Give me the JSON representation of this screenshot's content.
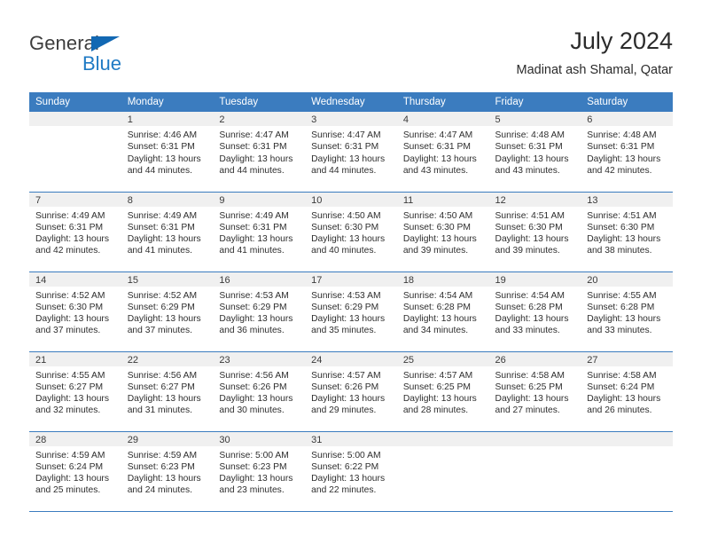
{
  "brand": {
    "general": "General",
    "blue": "Blue",
    "triangle_color": "#1268b3",
    "blue_text_color": "#1f7ac4"
  },
  "header": {
    "title": "July 2024",
    "subtitle": "Madinat ash Shamal, Qatar"
  },
  "theme": {
    "header_bar_color": "#3b7cbf",
    "daynum_bg_color": "#f0f0f0",
    "row_border_color": "#3b7cbf",
    "text_color": "#2e2e2e"
  },
  "calendar": {
    "weekday_headers": [
      "Sunday",
      "Monday",
      "Tuesday",
      "Wednesday",
      "Thursday",
      "Friday",
      "Saturday"
    ],
    "weeks": [
      [
        {
          "day": "",
          "lines": []
        },
        {
          "day": "1",
          "lines": [
            "Sunrise: 4:46 AM",
            "Sunset: 6:31 PM",
            "Daylight: 13 hours",
            "and 44 minutes."
          ]
        },
        {
          "day": "2",
          "lines": [
            "Sunrise: 4:47 AM",
            "Sunset: 6:31 PM",
            "Daylight: 13 hours",
            "and 44 minutes."
          ]
        },
        {
          "day": "3",
          "lines": [
            "Sunrise: 4:47 AM",
            "Sunset: 6:31 PM",
            "Daylight: 13 hours",
            "and 44 minutes."
          ]
        },
        {
          "day": "4",
          "lines": [
            "Sunrise: 4:47 AM",
            "Sunset: 6:31 PM",
            "Daylight: 13 hours",
            "and 43 minutes."
          ]
        },
        {
          "day": "5",
          "lines": [
            "Sunrise: 4:48 AM",
            "Sunset: 6:31 PM",
            "Daylight: 13 hours",
            "and 43 minutes."
          ]
        },
        {
          "day": "6",
          "lines": [
            "Sunrise: 4:48 AM",
            "Sunset: 6:31 PM",
            "Daylight: 13 hours",
            "and 42 minutes."
          ]
        }
      ],
      [
        {
          "day": "7",
          "lines": [
            "Sunrise: 4:49 AM",
            "Sunset: 6:31 PM",
            "Daylight: 13 hours",
            "and 42 minutes."
          ]
        },
        {
          "day": "8",
          "lines": [
            "Sunrise: 4:49 AM",
            "Sunset: 6:31 PM",
            "Daylight: 13 hours",
            "and 41 minutes."
          ]
        },
        {
          "day": "9",
          "lines": [
            "Sunrise: 4:49 AM",
            "Sunset: 6:31 PM",
            "Daylight: 13 hours",
            "and 41 minutes."
          ]
        },
        {
          "day": "10",
          "lines": [
            "Sunrise: 4:50 AM",
            "Sunset: 6:30 PM",
            "Daylight: 13 hours",
            "and 40 minutes."
          ]
        },
        {
          "day": "11",
          "lines": [
            "Sunrise: 4:50 AM",
            "Sunset: 6:30 PM",
            "Daylight: 13 hours",
            "and 39 minutes."
          ]
        },
        {
          "day": "12",
          "lines": [
            "Sunrise: 4:51 AM",
            "Sunset: 6:30 PM",
            "Daylight: 13 hours",
            "and 39 minutes."
          ]
        },
        {
          "day": "13",
          "lines": [
            "Sunrise: 4:51 AM",
            "Sunset: 6:30 PM",
            "Daylight: 13 hours",
            "and 38 minutes."
          ]
        }
      ],
      [
        {
          "day": "14",
          "lines": [
            "Sunrise: 4:52 AM",
            "Sunset: 6:30 PM",
            "Daylight: 13 hours",
            "and 37 minutes."
          ]
        },
        {
          "day": "15",
          "lines": [
            "Sunrise: 4:52 AM",
            "Sunset: 6:29 PM",
            "Daylight: 13 hours",
            "and 37 minutes."
          ]
        },
        {
          "day": "16",
          "lines": [
            "Sunrise: 4:53 AM",
            "Sunset: 6:29 PM",
            "Daylight: 13 hours",
            "and 36 minutes."
          ]
        },
        {
          "day": "17",
          "lines": [
            "Sunrise: 4:53 AM",
            "Sunset: 6:29 PM",
            "Daylight: 13 hours",
            "and 35 minutes."
          ]
        },
        {
          "day": "18",
          "lines": [
            "Sunrise: 4:54 AM",
            "Sunset: 6:28 PM",
            "Daylight: 13 hours",
            "and 34 minutes."
          ]
        },
        {
          "day": "19",
          "lines": [
            "Sunrise: 4:54 AM",
            "Sunset: 6:28 PM",
            "Daylight: 13 hours",
            "and 33 minutes."
          ]
        },
        {
          "day": "20",
          "lines": [
            "Sunrise: 4:55 AM",
            "Sunset: 6:28 PM",
            "Daylight: 13 hours",
            "and 33 minutes."
          ]
        }
      ],
      [
        {
          "day": "21",
          "lines": [
            "Sunrise: 4:55 AM",
            "Sunset: 6:27 PM",
            "Daylight: 13 hours",
            "and 32 minutes."
          ]
        },
        {
          "day": "22",
          "lines": [
            "Sunrise: 4:56 AM",
            "Sunset: 6:27 PM",
            "Daylight: 13 hours",
            "and 31 minutes."
          ]
        },
        {
          "day": "23",
          "lines": [
            "Sunrise: 4:56 AM",
            "Sunset: 6:26 PM",
            "Daylight: 13 hours",
            "and 30 minutes."
          ]
        },
        {
          "day": "24",
          "lines": [
            "Sunrise: 4:57 AM",
            "Sunset: 6:26 PM",
            "Daylight: 13 hours",
            "and 29 minutes."
          ]
        },
        {
          "day": "25",
          "lines": [
            "Sunrise: 4:57 AM",
            "Sunset: 6:25 PM",
            "Daylight: 13 hours",
            "and 28 minutes."
          ]
        },
        {
          "day": "26",
          "lines": [
            "Sunrise: 4:58 AM",
            "Sunset: 6:25 PM",
            "Daylight: 13 hours",
            "and 27 minutes."
          ]
        },
        {
          "day": "27",
          "lines": [
            "Sunrise: 4:58 AM",
            "Sunset: 6:24 PM",
            "Daylight: 13 hours",
            "and 26 minutes."
          ]
        }
      ],
      [
        {
          "day": "28",
          "lines": [
            "Sunrise: 4:59 AM",
            "Sunset: 6:24 PM",
            "Daylight: 13 hours",
            "and 25 minutes."
          ]
        },
        {
          "day": "29",
          "lines": [
            "Sunrise: 4:59 AM",
            "Sunset: 6:23 PM",
            "Daylight: 13 hours",
            "and 24 minutes."
          ]
        },
        {
          "day": "30",
          "lines": [
            "Sunrise: 5:00 AM",
            "Sunset: 6:23 PM",
            "Daylight: 13 hours",
            "and 23 minutes."
          ]
        },
        {
          "day": "31",
          "lines": [
            "Sunrise: 5:00 AM",
            "Sunset: 6:22 PM",
            "Daylight: 13 hours",
            "and 22 minutes."
          ]
        },
        {
          "day": "",
          "lines": []
        },
        {
          "day": "",
          "lines": []
        },
        {
          "day": "",
          "lines": []
        }
      ]
    ]
  }
}
